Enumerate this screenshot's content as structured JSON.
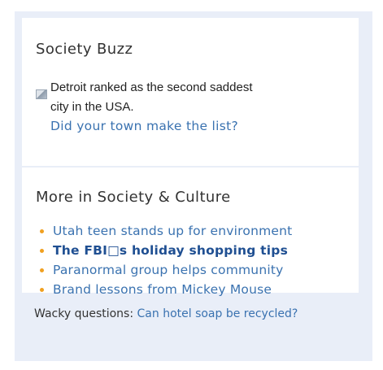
{
  "buzz": {
    "title": "Society Buzz",
    "thumbnail_icon": "broken-image-icon",
    "headline": "Detroit ranked as the second saddest city in the USA.",
    "link": "Did your town make the list?"
  },
  "more": {
    "title": "More in Society & Culture",
    "items": [
      {
        "label": "Utah teen stands up for environment",
        "bold": false
      },
      {
        "label": "The FBI□s holiday shopping tips",
        "bold": true
      },
      {
        "label": "Paranormal group helps community",
        "bold": false
      },
      {
        "label": "Brand lessons from Mickey Mouse",
        "bold": false
      }
    ],
    "bullet_color": "#f0a020"
  },
  "footer": {
    "prefix": "Wacky questions: ",
    "link": "Can hotel soap be recycled?"
  },
  "colors": {
    "link": "#3a72b0",
    "bold_link": "#1f4f92",
    "panel_background": "#e9eef8"
  }
}
